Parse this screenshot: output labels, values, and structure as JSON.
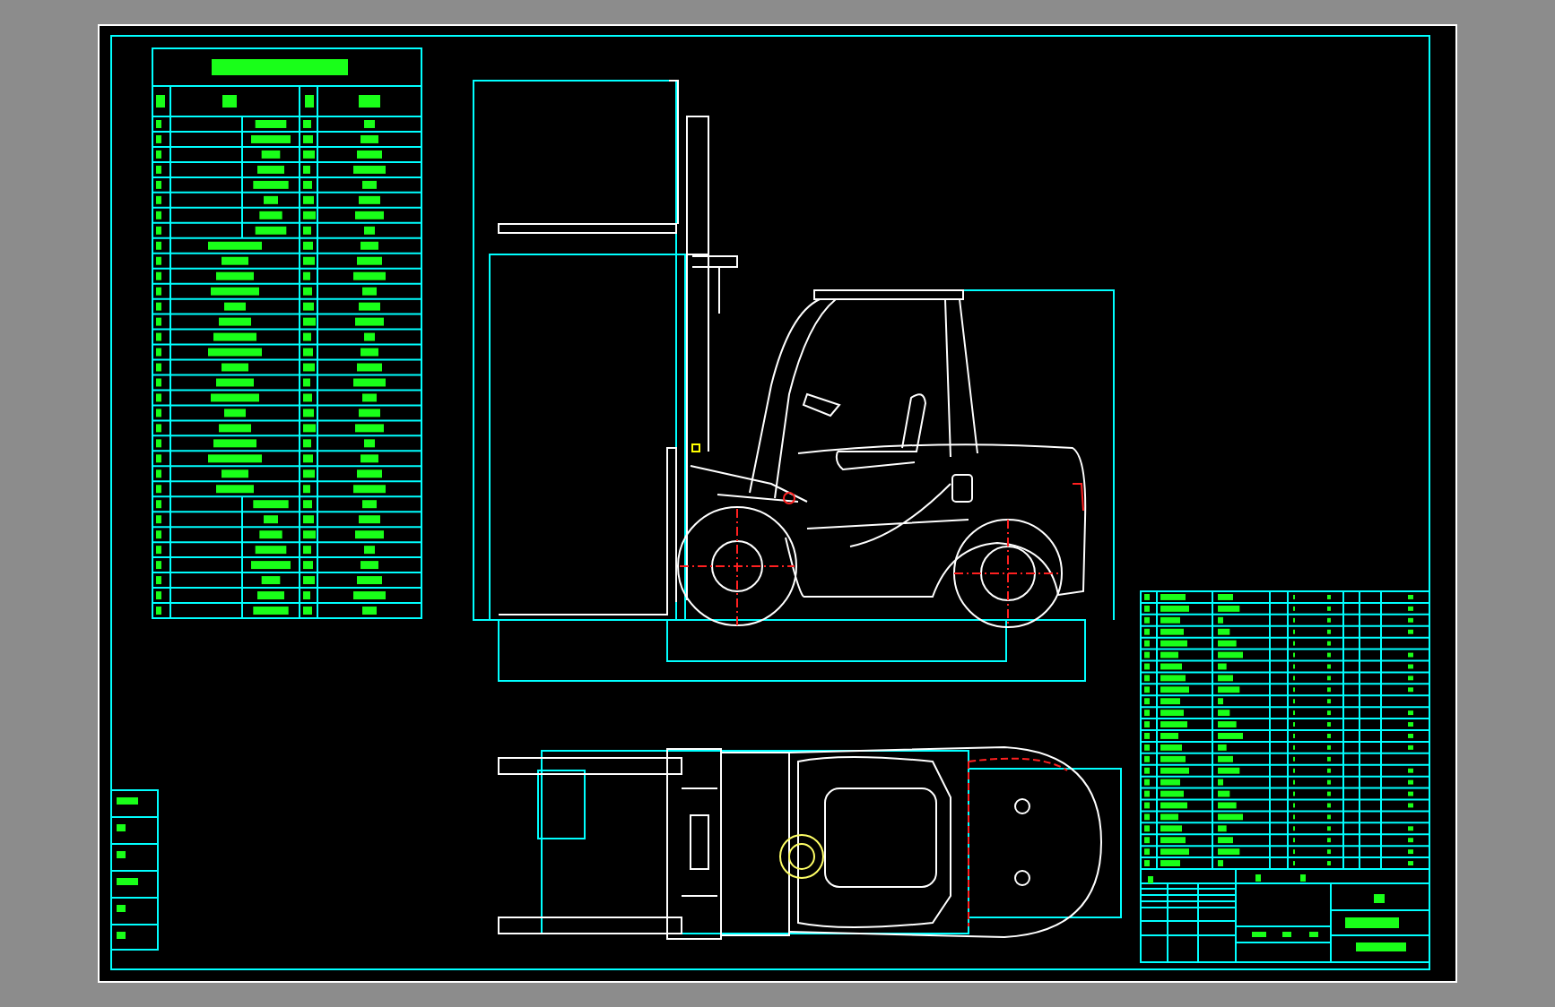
{
  "drawing": {
    "views": [
      {
        "kind": "side-elevation"
      },
      {
        "kind": "plan"
      }
    ],
    "tables": [
      {
        "kind": "parameter"
      },
      {
        "kind": "parts-list"
      },
      {
        "kind": "title-block"
      },
      {
        "kind": "revision-strip"
      }
    ]
  }
}
